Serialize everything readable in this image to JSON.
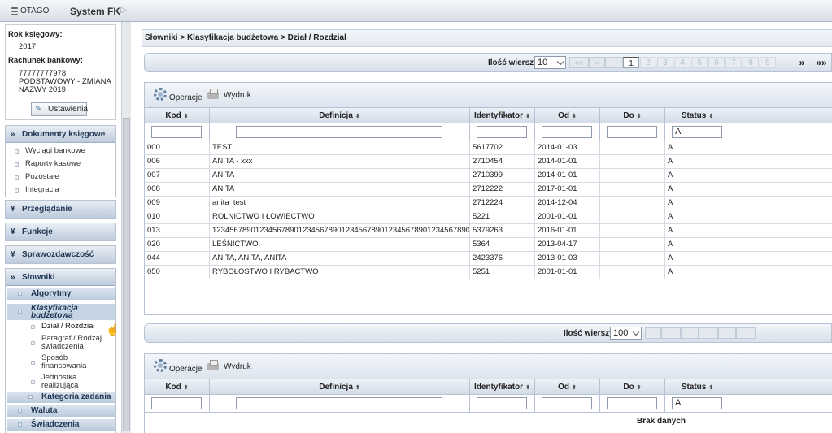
{
  "app": {
    "logo": "OTAGO",
    "title": "System FK",
    "arrow": "▷"
  },
  "info": {
    "rok_label": "Rok księgowy:",
    "rok_value": "2017",
    "rachunek_label": "Rachunek bankowy:",
    "rachunek_lines": [
      "77777777978",
      "PODSTAWOWY - ZMIANA",
      "NAZWY 2019"
    ],
    "ustawienia": "Ustawienia"
  },
  "nav": {
    "dokumenty": {
      "label": "Dokumenty księgowe",
      "items": [
        "Wyciągi bankowe",
        "Raporty kasowe",
        "Pozostałe",
        "Integracja"
      ]
    },
    "przegladanie": "Przeglądanie",
    "funkcje": "Funkcje",
    "sprawozdawczosc": "Sprawozdawczość",
    "slowniki": {
      "label": "Słowniki",
      "algorytmy": "Algorytmy",
      "klasyfikacja": [
        "Klasyfikacja",
        "budżetowa"
      ],
      "klas_items": [
        [
          "Dział / Rozdział"
        ],
        [
          "Paragraf / Rodzaj",
          "świadczenia"
        ],
        [
          "Sposób",
          "finansowania"
        ],
        [
          "Jednostka",
          "realizująca"
        ]
      ],
      "kategoria": "Kategoria zadania",
      "waluta": "Waluta",
      "swiadczenia": "Świadczenia"
    }
  },
  "breadcrumb": "Słowniki > Klasyfikacja budżetowa > Dział / Rozdział",
  "pager1": {
    "label": "Ilość wierszy",
    "rows": "10",
    "first": "««",
    "prev": "«",
    "next": "»",
    "last": "»»",
    "pages": [
      "1",
      "2",
      "3",
      "4",
      "5",
      "6",
      "7",
      "8",
      "9"
    ],
    "current": "1"
  },
  "pager2": {
    "label": "Ilość wierszy",
    "rows": "100"
  },
  "toolbar": {
    "operacje": "Operacje",
    "wydruk": "Wydruk"
  },
  "columns": [
    "Kod",
    "Definicja",
    "Identyfikator",
    "Od",
    "Do",
    "Status"
  ],
  "sort_glyph": "⬍",
  "filter_status": "A",
  "rows": [
    [
      "000",
      "TEST",
      "5617702",
      "2014-01-03",
      "",
      "A"
    ],
    [
      "006",
      "ANITA - xxx",
      "2710454",
      "2014-01-01",
      "",
      "A"
    ],
    [
      "007",
      "ANITA",
      "2710399",
      "2014-01-01",
      "",
      "A"
    ],
    [
      "008",
      "ANITA",
      "2712222",
      "2017-01-01",
      "",
      "A"
    ],
    [
      "009",
      "anita_test",
      "2712224",
      "2014-12-04",
      "",
      "A"
    ],
    [
      "010",
      "ROLNICTWO I ŁOWIECTWO",
      "5221",
      "2001-01-01",
      "",
      "A"
    ],
    [
      "013",
      "12345678901234567890123456789012345678901234567890123456789012...",
      "5379263",
      "2016-01-01",
      "",
      "A"
    ],
    [
      "020",
      "LEŚNICTWO.",
      "5364",
      "2013-04-17",
      "",
      "A"
    ],
    [
      "044",
      "ANITA, ANITA, ANITA",
      "2423376",
      "2013-01-03",
      "",
      "A"
    ],
    [
      "050",
      "RYBOŁOSTWO I RYBACTWO",
      "5251",
      "2001-01-01",
      "",
      "A"
    ]
  ],
  "nodata": "Brak danych"
}
